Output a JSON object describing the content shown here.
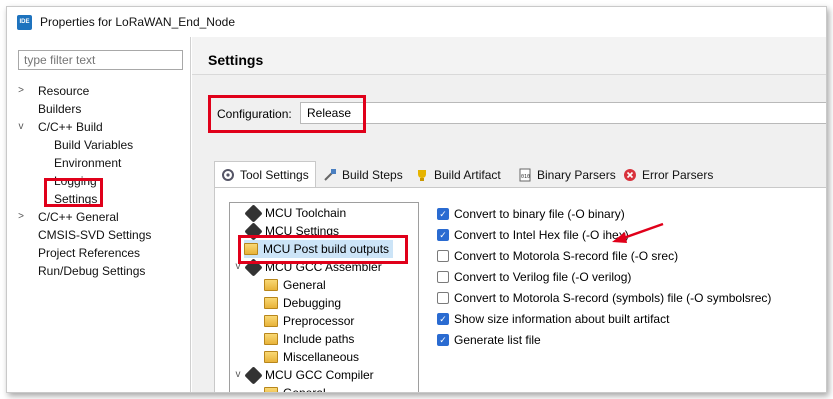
{
  "window": {
    "title": "Properties for LoRaWAN_End_Node",
    "app_icon": "IDE"
  },
  "sidebar": {
    "filter_placeholder": "type filter text",
    "items": [
      {
        "label": "Resource",
        "twisty": ">"
      },
      {
        "label": "Builders"
      },
      {
        "label": "C/C++ Build",
        "twisty": "v"
      },
      {
        "label": "Build Variables"
      },
      {
        "label": "Environment"
      },
      {
        "label": "Logging"
      },
      {
        "label": "Settings"
      },
      {
        "label": "C/C++ General",
        "twisty": ">"
      },
      {
        "label": "CMSIS-SVD Settings"
      },
      {
        "label": "Project References"
      },
      {
        "label": "Run/Debug Settings"
      }
    ]
  },
  "main": {
    "header": "Settings",
    "configuration_label": "Configuration:",
    "configuration_value": "Release",
    "tabs": [
      {
        "label": "Tool Settings",
        "icon": "tools-icon"
      },
      {
        "label": "Build Steps",
        "icon": "build-steps-icon"
      },
      {
        "label": "Build Artifact",
        "icon": "trophy-icon"
      },
      {
        "label": "Binary Parsers",
        "icon": "binary-icon"
      },
      {
        "label": "Error Parsers",
        "icon": "error-icon"
      }
    ],
    "tree": [
      {
        "label": "MCU Toolchain"
      },
      {
        "label": "MCU Settings"
      },
      {
        "label": "MCU Post build outputs"
      },
      {
        "label": "MCU GCC Assembler",
        "twisty": "v"
      },
      {
        "label": "General"
      },
      {
        "label": "Debugging"
      },
      {
        "label": "Preprocessor"
      },
      {
        "label": "Include paths"
      },
      {
        "label": "Miscellaneous"
      },
      {
        "label": "MCU GCC Compiler",
        "twisty": "v"
      },
      {
        "label": "General"
      }
    ],
    "options": [
      {
        "label": "Convert to binary file (-O binary)",
        "checked": true
      },
      {
        "label": "Convert to Intel Hex file (-O ihex)",
        "checked": true
      },
      {
        "label": "Convert to Motorola S-record file (-O srec)",
        "checked": false
      },
      {
        "label": "Convert to Verilog file (-O verilog)",
        "checked": false
      },
      {
        "label": "Convert to Motorola S-record (symbols) file (-O symbolsrec)",
        "checked": false
      },
      {
        "label": "Show size information about built artifact",
        "checked": true
      },
      {
        "label": "Generate list file",
        "checked": true
      }
    ]
  },
  "colors": {
    "highlight": "#e0001a",
    "accent": "#2a6bd1",
    "selection": "#cce4f7"
  }
}
